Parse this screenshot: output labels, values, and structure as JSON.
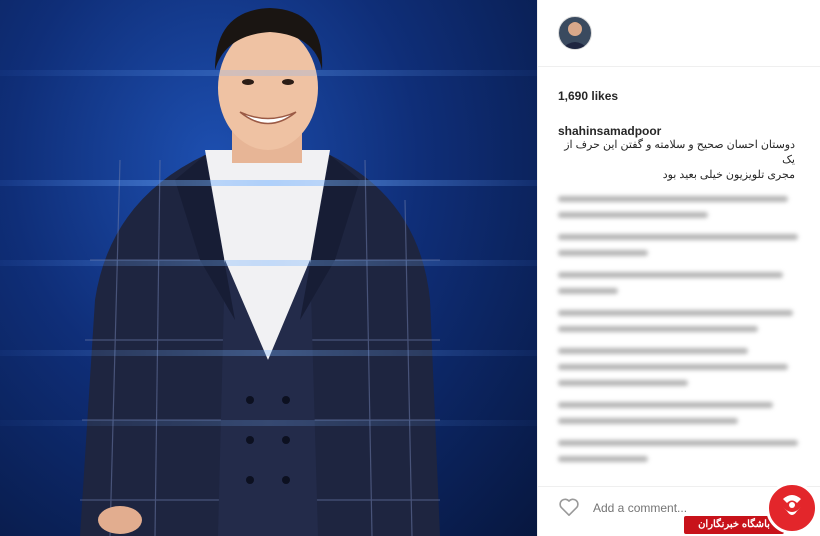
{
  "post": {
    "likes": "1,690 likes",
    "username": "shahinsamadpoor",
    "caption_line1": "دوستان احسان صحیح و سلامته و گفتن این حرف از یک",
    "caption_line2": "مجری تلویزیون خیلی بعید بود"
  },
  "comment_box": {
    "placeholder": "Add a comment..."
  },
  "watermark": {
    "text": "باشگاه خبرنگاران"
  },
  "colors": {
    "photo_bg": "#0f2e78",
    "suit": "#1e2540",
    "logo_red": "#e3262b"
  }
}
